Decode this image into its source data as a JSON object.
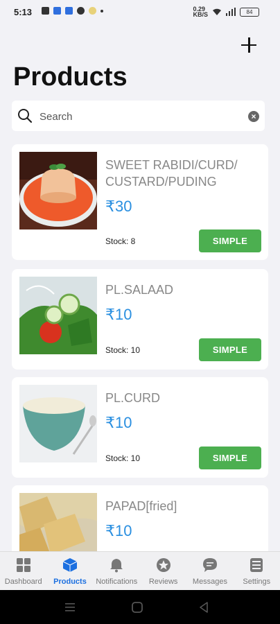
{
  "status": {
    "time": "5:13",
    "network": "0.29\nKB/S",
    "battery": "84"
  },
  "header": {
    "title": "Products",
    "add_icon": "plus-icon"
  },
  "search": {
    "placeholder": "Search",
    "value": ""
  },
  "products": [
    {
      "name": "SWEET RABIDI/CURD/\nCUSTARD/PUDING",
      "price": "₹30",
      "stock": "Stock: 8",
      "type_label": "SIMPLE"
    },
    {
      "name": "PL.SALAAD",
      "price": "₹10",
      "stock": "Stock: 10",
      "type_label": "SIMPLE"
    },
    {
      "name": "PL.CURD",
      "price": "₹10",
      "stock": "Stock: 10",
      "type_label": "SIMPLE"
    },
    {
      "name": "PAPAD[fried]",
      "price": "₹10",
      "stock": "",
      "type_label": ""
    }
  ],
  "nav": {
    "items": [
      {
        "label": "Dashboard",
        "icon": "grid-icon",
        "active": false
      },
      {
        "label": "Products",
        "icon": "cube-icon",
        "active": true
      },
      {
        "label": "Notifications",
        "icon": "bell-icon",
        "active": false
      },
      {
        "label": "Reviews",
        "icon": "star-icon",
        "active": false
      },
      {
        "label": "Messages",
        "icon": "chat-icon",
        "active": false
      },
      {
        "label": "Settings",
        "icon": "list-icon",
        "active": false
      }
    ]
  },
  "colors": {
    "accent": "#1b6fe0",
    "price": "#2a8fe0",
    "button_green": "#4caf50"
  }
}
